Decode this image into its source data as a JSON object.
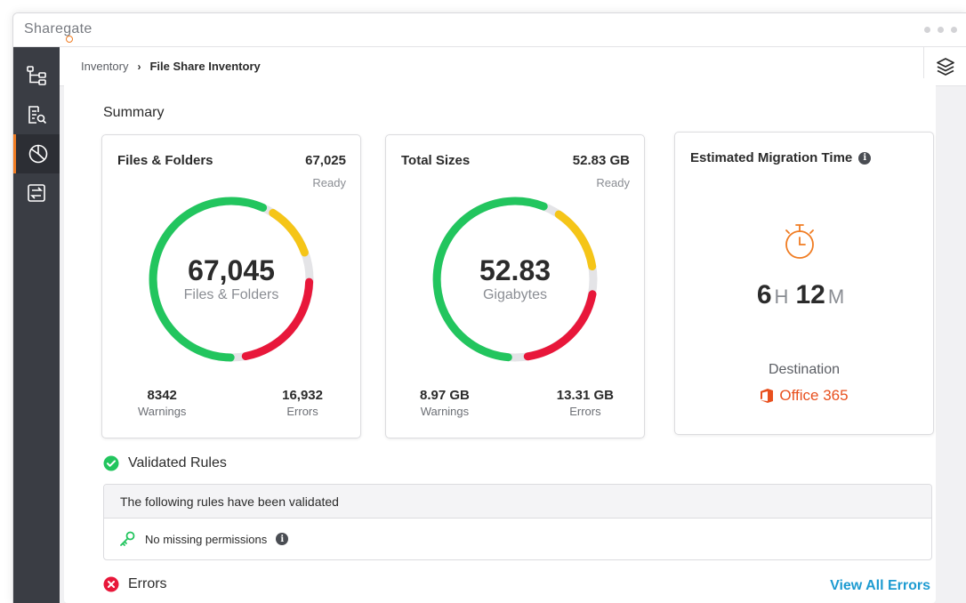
{
  "app": {
    "logo_text_before": "Share",
    "logo_text_g": "g",
    "logo_text_after": "ate"
  },
  "breadcrumb": {
    "root": "Inventory",
    "separator": "›",
    "current": "File Share Inventory"
  },
  "summary": {
    "title": "Summary",
    "files_folders": {
      "title": "Files & Folders",
      "ready_count": "67,025",
      "ready_label": "Ready",
      "total": "67,045",
      "unit": "Files & Folders",
      "warnings_count": "8342",
      "warnings_label": "Warnings",
      "errors_count": "16,932",
      "errors_label": "Errors"
    },
    "total_sizes": {
      "title": "Total Sizes",
      "ready_size": "52.83 GB",
      "ready_label": "Ready",
      "total": "52.83",
      "unit": "Gigabytes",
      "warnings_size": "8.97 GB",
      "warnings_label": "Warnings",
      "errors_size": "13.31 GB",
      "errors_label": "Errors"
    },
    "migration_time": {
      "title": "Estimated Migration Time",
      "hours": "6",
      "hours_unit": "H",
      "minutes": "12",
      "minutes_unit": "M",
      "destination_label": "Destination",
      "destination_value": "Office 365"
    }
  },
  "validated_rules": {
    "title": "Validated Rules",
    "header": "The following rules have been validated",
    "items": [
      {
        "label": "No missing permissions"
      }
    ]
  },
  "errors": {
    "title": "Errors",
    "view_all": "View All Errors"
  },
  "colors": {
    "accent_orange": "#f07c22",
    "ready_green": "#22c55e",
    "warning_yellow": "#f5c518",
    "error_red": "#e8173a",
    "link_blue": "#1d9bd1",
    "office_orange": "#e8501e"
  },
  "icons": {
    "sidebar": [
      "hierarchy-icon",
      "report-search-icon",
      "pie-chart-icon",
      "transfer-icon"
    ],
    "toolbar": [
      "layers-icon"
    ],
    "status": [
      "check-circle-icon",
      "error-circle-icon",
      "info-icon",
      "key-icon",
      "stopwatch-icon",
      "office-icon"
    ]
  }
}
